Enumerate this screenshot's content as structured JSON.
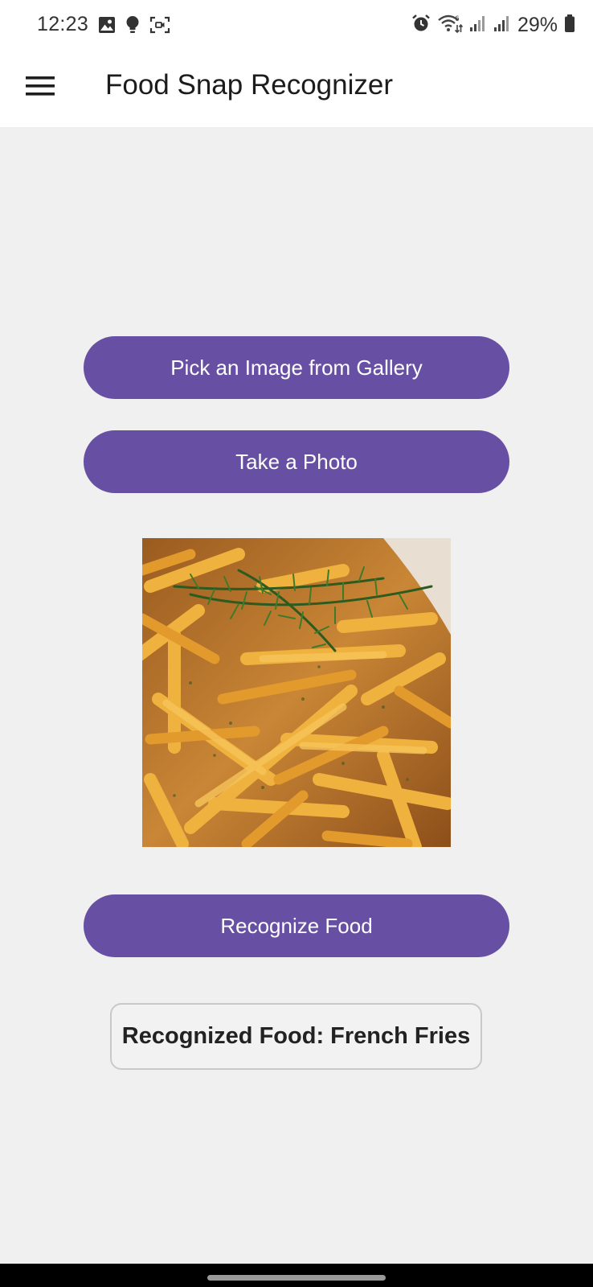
{
  "status_bar": {
    "time": "12:23",
    "battery_percent": "29%",
    "left_icons": [
      "image-icon",
      "bulb-icon",
      "screen-record-icon"
    ],
    "right_icons": [
      "alarm-icon",
      "wifi-icon",
      "signal-icon",
      "signal-icon",
      "battery-icon"
    ]
  },
  "app_bar": {
    "title": "Food Snap Recognizer",
    "menu_icon": "hamburger-menu-icon"
  },
  "main": {
    "pick_gallery_label": "Pick an Image from Gallery",
    "take_photo_label": "Take a Photo",
    "image_subject": "French fries with rosemary",
    "recognize_label": "Recognize Food",
    "result_text": "Recognized Food: French Fries"
  },
  "colors": {
    "primary": "#6750a4",
    "background": "#f0f0f0",
    "app_bar": "#ffffff",
    "nav_bar": "#000000"
  }
}
